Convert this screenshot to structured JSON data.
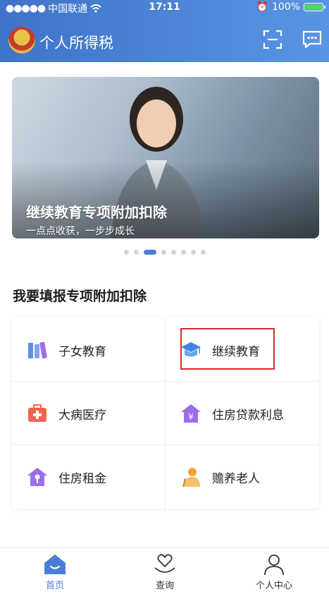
{
  "status_bar": {
    "carrier": "中国联通",
    "time": "17:11",
    "battery": "100%"
  },
  "navbar": {
    "title": "个人所得税",
    "icons": [
      "scan-icon",
      "message-icon"
    ]
  },
  "banner": {
    "title": "继续教育专项附加扣除",
    "subtitle": "一点点收获，一步步成长",
    "page_count": 8,
    "active_page": 3
  },
  "section": {
    "title": "我要填报专项附加扣除"
  },
  "deductions": [
    {
      "label": "子女教育",
      "icon": "books-icon",
      "color": "#5b8fe0"
    },
    {
      "label": "继续教育",
      "icon": "graduation-cap-icon",
      "color": "#3f86e0"
    },
    {
      "label": "大病医疗",
      "icon": "medical-kit-icon",
      "color": "#f0644f"
    },
    {
      "label": "住房贷款利息",
      "icon": "house-yuan-icon",
      "color": "#9b6ee8"
    },
    {
      "label": "住房租金",
      "icon": "house-key-icon",
      "color": "#9b6ee8"
    },
    {
      "label": "赡养老人",
      "icon": "elderly-person-icon",
      "color": "#f3a33a"
    }
  ],
  "tabbar": {
    "tabs": [
      {
        "label": "首页",
        "icon": "home-icon"
      },
      {
        "label": "查询",
        "icon": "heart-hand-icon"
      },
      {
        "label": "个人中心",
        "icon": "user-icon"
      }
    ]
  },
  "colors": {
    "header": "#4a80d2",
    "accent": "#4a7fd4",
    "highlight_box": "#e0262b"
  }
}
